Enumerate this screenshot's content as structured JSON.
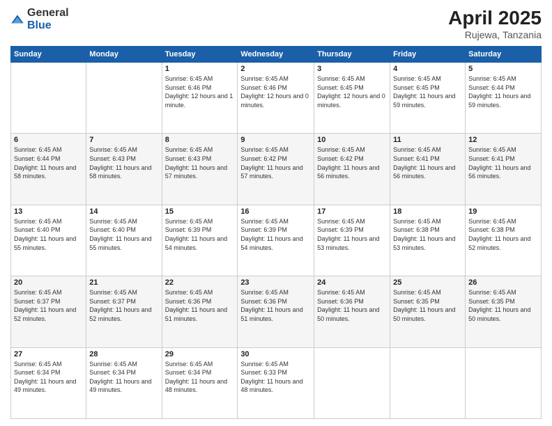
{
  "logo": {
    "general": "General",
    "blue": "Blue"
  },
  "header": {
    "month": "April 2025",
    "location": "Rujewa, Tanzania"
  },
  "days_of_week": [
    "Sunday",
    "Monday",
    "Tuesday",
    "Wednesday",
    "Thursday",
    "Friday",
    "Saturday"
  ],
  "weeks": [
    [
      {
        "day": "",
        "info": ""
      },
      {
        "day": "",
        "info": ""
      },
      {
        "day": "1",
        "info": "Sunrise: 6:45 AM\nSunset: 6:46 PM\nDaylight: 12 hours and 1 minute."
      },
      {
        "day": "2",
        "info": "Sunrise: 6:45 AM\nSunset: 6:46 PM\nDaylight: 12 hours and 0 minutes."
      },
      {
        "day": "3",
        "info": "Sunrise: 6:45 AM\nSunset: 6:45 PM\nDaylight: 12 hours and 0 minutes."
      },
      {
        "day": "4",
        "info": "Sunrise: 6:45 AM\nSunset: 6:45 PM\nDaylight: 11 hours and 59 minutes."
      },
      {
        "day": "5",
        "info": "Sunrise: 6:45 AM\nSunset: 6:44 PM\nDaylight: 11 hours and 59 minutes."
      }
    ],
    [
      {
        "day": "6",
        "info": "Sunrise: 6:45 AM\nSunset: 6:44 PM\nDaylight: 11 hours and 58 minutes."
      },
      {
        "day": "7",
        "info": "Sunrise: 6:45 AM\nSunset: 6:43 PM\nDaylight: 11 hours and 58 minutes."
      },
      {
        "day": "8",
        "info": "Sunrise: 6:45 AM\nSunset: 6:43 PM\nDaylight: 11 hours and 57 minutes."
      },
      {
        "day": "9",
        "info": "Sunrise: 6:45 AM\nSunset: 6:42 PM\nDaylight: 11 hours and 57 minutes."
      },
      {
        "day": "10",
        "info": "Sunrise: 6:45 AM\nSunset: 6:42 PM\nDaylight: 11 hours and 56 minutes."
      },
      {
        "day": "11",
        "info": "Sunrise: 6:45 AM\nSunset: 6:41 PM\nDaylight: 11 hours and 56 minutes."
      },
      {
        "day": "12",
        "info": "Sunrise: 6:45 AM\nSunset: 6:41 PM\nDaylight: 11 hours and 56 minutes."
      }
    ],
    [
      {
        "day": "13",
        "info": "Sunrise: 6:45 AM\nSunset: 6:40 PM\nDaylight: 11 hours and 55 minutes."
      },
      {
        "day": "14",
        "info": "Sunrise: 6:45 AM\nSunset: 6:40 PM\nDaylight: 11 hours and 55 minutes."
      },
      {
        "day": "15",
        "info": "Sunrise: 6:45 AM\nSunset: 6:39 PM\nDaylight: 11 hours and 54 minutes."
      },
      {
        "day": "16",
        "info": "Sunrise: 6:45 AM\nSunset: 6:39 PM\nDaylight: 11 hours and 54 minutes."
      },
      {
        "day": "17",
        "info": "Sunrise: 6:45 AM\nSunset: 6:39 PM\nDaylight: 11 hours and 53 minutes."
      },
      {
        "day": "18",
        "info": "Sunrise: 6:45 AM\nSunset: 6:38 PM\nDaylight: 11 hours and 53 minutes."
      },
      {
        "day": "19",
        "info": "Sunrise: 6:45 AM\nSunset: 6:38 PM\nDaylight: 11 hours and 52 minutes."
      }
    ],
    [
      {
        "day": "20",
        "info": "Sunrise: 6:45 AM\nSunset: 6:37 PM\nDaylight: 11 hours and 52 minutes."
      },
      {
        "day": "21",
        "info": "Sunrise: 6:45 AM\nSunset: 6:37 PM\nDaylight: 11 hours and 52 minutes."
      },
      {
        "day": "22",
        "info": "Sunrise: 6:45 AM\nSunset: 6:36 PM\nDaylight: 11 hours and 51 minutes."
      },
      {
        "day": "23",
        "info": "Sunrise: 6:45 AM\nSunset: 6:36 PM\nDaylight: 11 hours and 51 minutes."
      },
      {
        "day": "24",
        "info": "Sunrise: 6:45 AM\nSunset: 6:36 PM\nDaylight: 11 hours and 50 minutes."
      },
      {
        "day": "25",
        "info": "Sunrise: 6:45 AM\nSunset: 6:35 PM\nDaylight: 11 hours and 50 minutes."
      },
      {
        "day": "26",
        "info": "Sunrise: 6:45 AM\nSunset: 6:35 PM\nDaylight: 11 hours and 50 minutes."
      }
    ],
    [
      {
        "day": "27",
        "info": "Sunrise: 6:45 AM\nSunset: 6:34 PM\nDaylight: 11 hours and 49 minutes."
      },
      {
        "day": "28",
        "info": "Sunrise: 6:45 AM\nSunset: 6:34 PM\nDaylight: 11 hours and 49 minutes."
      },
      {
        "day": "29",
        "info": "Sunrise: 6:45 AM\nSunset: 6:34 PM\nDaylight: 11 hours and 48 minutes."
      },
      {
        "day": "30",
        "info": "Sunrise: 6:45 AM\nSunset: 6:33 PM\nDaylight: 11 hours and 48 minutes."
      },
      {
        "day": "",
        "info": ""
      },
      {
        "day": "",
        "info": ""
      },
      {
        "day": "",
        "info": ""
      }
    ]
  ]
}
